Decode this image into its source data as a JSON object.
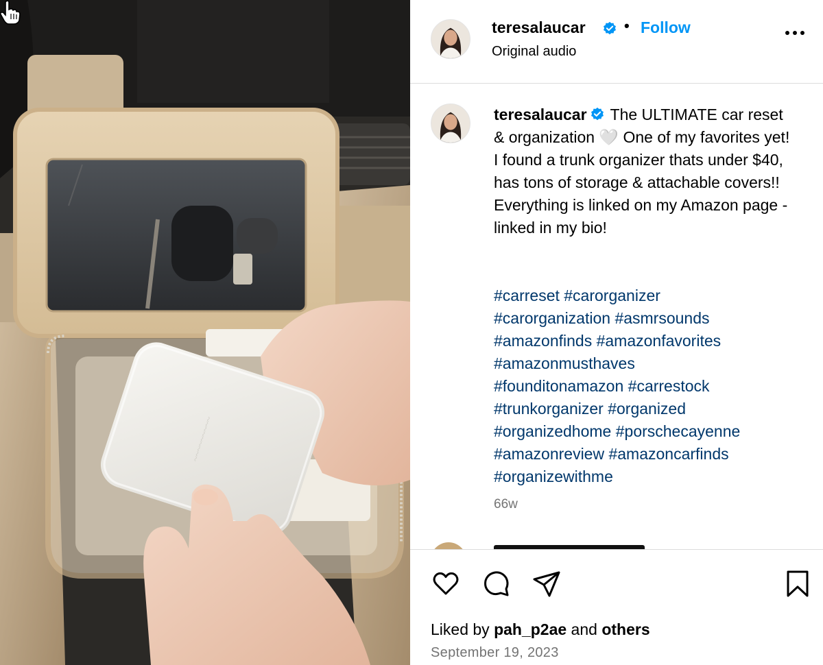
{
  "post": {
    "username": "teresalaucar",
    "separator": "•",
    "follow_label": "Follow",
    "audio_label": "Original audio"
  },
  "caption": {
    "username": "teresalaucar",
    "text": "The ULTIMATE car reset & organization 🤍 One of my favorites yet! I found a trunk organizer thats under $40, has tons of storage & attachable covers!! Everything is linked on my Amazon page - linked in my bio!",
    "hashtag_lines": [
      "#carreset #carorganizer",
      "#carorganization #asmrsounds",
      "#amazonfinds #amazonfavorites",
      "#amazonmusthaves",
      "#founditonamazon #carrestock",
      "#trunkorganizer #organized",
      "#organizedhome #porschecayenne",
      "#amazonreview #amazoncarfinds",
      "#organizewithme"
    ],
    "time_ago": "66w"
  },
  "footer": {
    "liked_by_prefix": "Liked by ",
    "liked_by_user": "pah_p2ae",
    "liked_by_middle": " and ",
    "liked_by_others": "others",
    "date": "September 19, 2023"
  },
  "icons": {
    "verified": "verified-badge-icon",
    "more": "more-options-icon",
    "like": "heart-icon",
    "comment": "comment-icon",
    "share": "paper-plane-icon",
    "save": "bookmark-icon",
    "cursor": "hand-pointer-icon"
  },
  "colors": {
    "link_blue": "#0095f6",
    "hashtag_blue": "#00376b",
    "secondary_text": "#737373",
    "divider": "#dbdbdb"
  }
}
